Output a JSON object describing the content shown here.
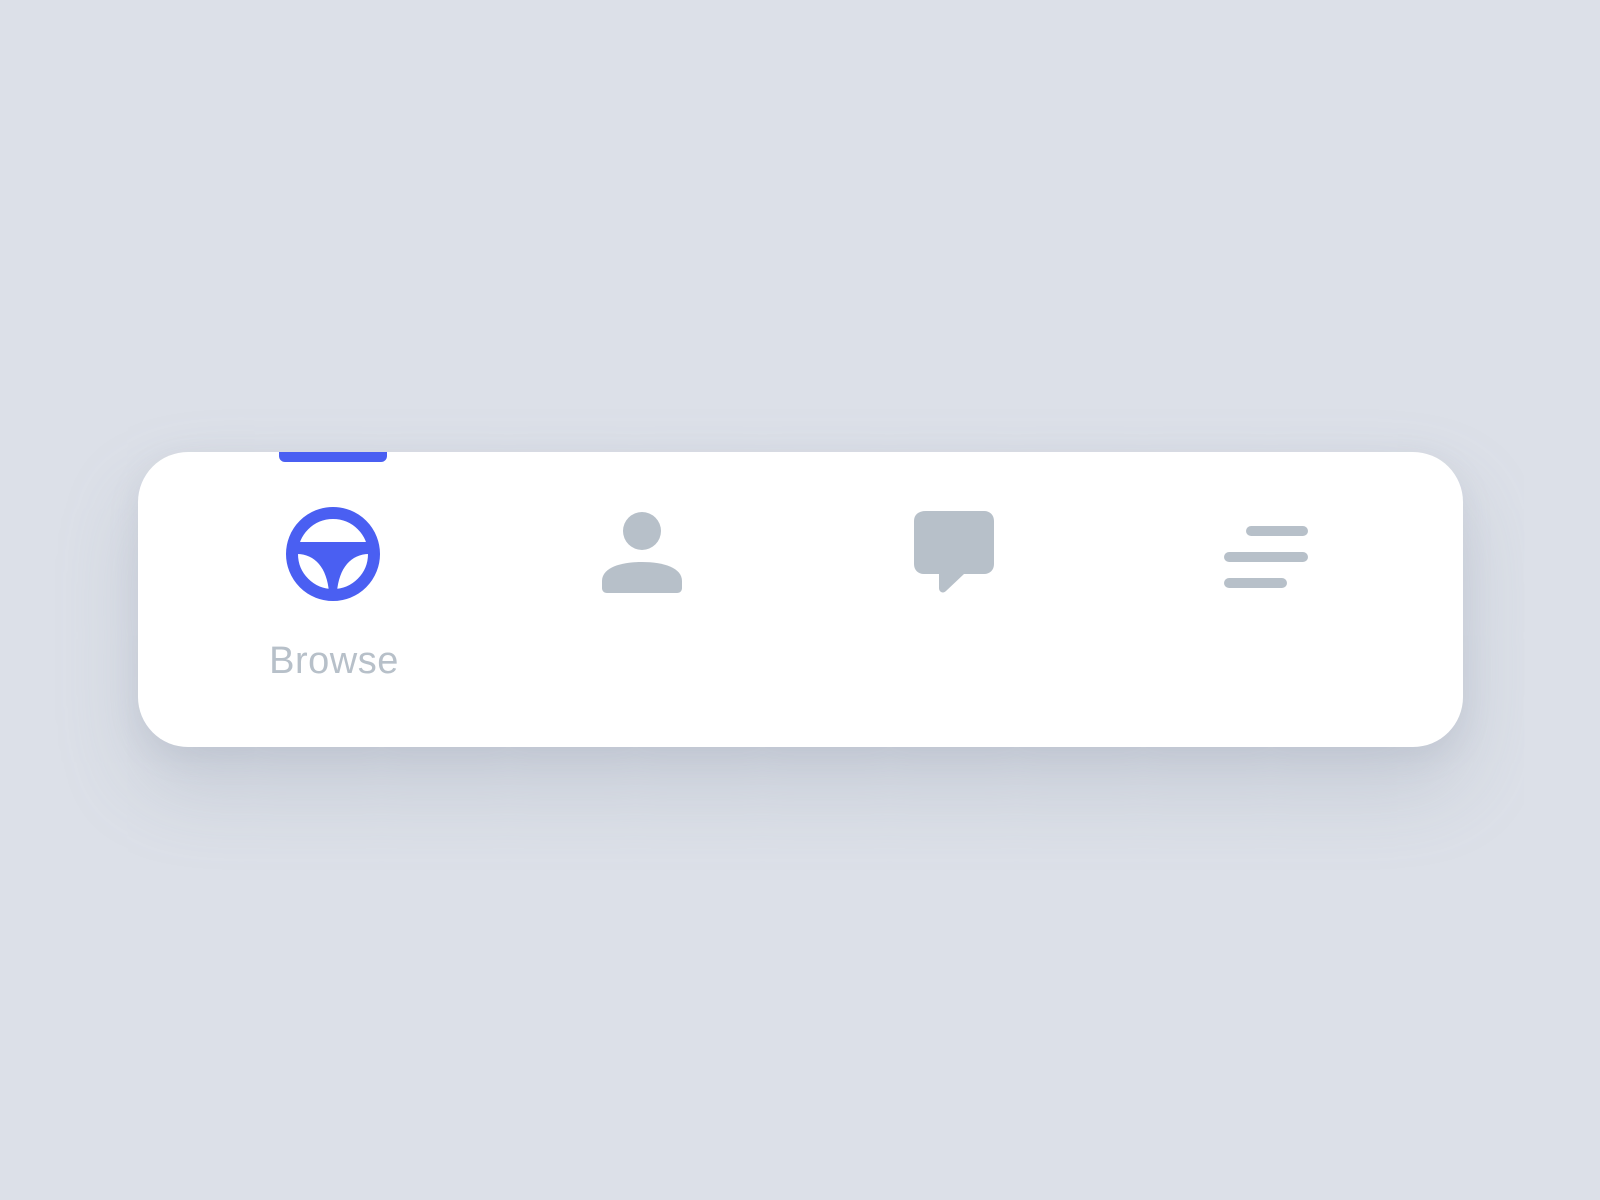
{
  "colors": {
    "background": "#dce0e8",
    "card": "#ffffff",
    "accent": "#4a5ff2",
    "inactive": "#b7c0c9"
  },
  "tabbar": {
    "active_tab": "browse",
    "tabs": [
      {
        "id": "browse",
        "label": "Browse",
        "icon": "steering-wheel-icon",
        "active": true
      },
      {
        "id": "profile",
        "label": "",
        "icon": "person-icon",
        "active": false
      },
      {
        "id": "messages",
        "label": "",
        "icon": "chat-bubble-icon",
        "active": false
      },
      {
        "id": "menu",
        "label": "",
        "icon": "menu-lines-icon",
        "active": false
      }
    ]
  }
}
